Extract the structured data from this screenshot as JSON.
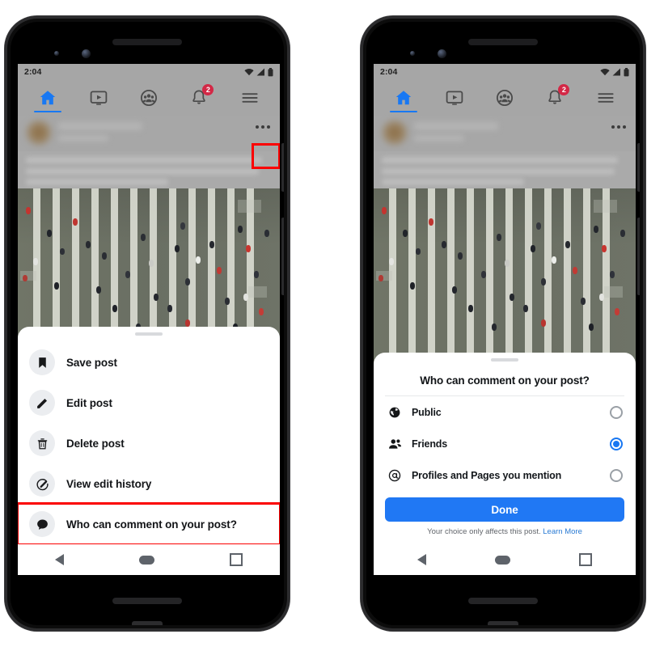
{
  "phones": {
    "left": {
      "label": "facebook-post-options-menu",
      "statusbar": {
        "time": "2:04",
        "icons": [
          "wifi-icon",
          "cellular-signal-icon",
          "battery-icon"
        ]
      },
      "topnav": {
        "items": [
          {
            "name": "home",
            "icon": "home-icon",
            "active": true
          },
          {
            "name": "watch",
            "icon": "video-play-icon",
            "active": false
          },
          {
            "name": "groups",
            "icon": "groups-icon",
            "active": false
          },
          {
            "name": "notifications",
            "icon": "bell-icon",
            "active": false,
            "badge": "2"
          },
          {
            "name": "menu",
            "icon": "hamburger-menu-icon",
            "active": false
          }
        ]
      },
      "post": {
        "author_blurred": true,
        "body_blurred": true,
        "more_options": "more-options-icon"
      },
      "photo": {
        "description": "aerial-view-pedestrian-crosswalk"
      },
      "menu": {
        "items": [
          {
            "label": "Save post",
            "icon": "bookmark-icon",
            "highlighted": false
          },
          {
            "label": "Edit post",
            "icon": "pencil-icon",
            "highlighted": false
          },
          {
            "label": "Delete post",
            "icon": "trash-icon",
            "highlighted": false
          },
          {
            "label": "View edit history",
            "icon": "edit-history-icon",
            "highlighted": false
          },
          {
            "label": "Who can comment on your post?",
            "icon": "comment-bubble-icon",
            "highlighted": true
          }
        ]
      },
      "androidnav": {
        "back": "back-triangle-icon",
        "home": "home-pill-icon",
        "recents": "recents-square-icon"
      }
    },
    "right": {
      "label": "who-can-comment-dialog",
      "statusbar": {
        "time": "2:04",
        "icons": [
          "wifi-icon",
          "cellular-signal-icon",
          "battery-icon"
        ]
      },
      "topnav": {
        "items": [
          {
            "name": "home",
            "icon": "home-icon",
            "active": true
          },
          {
            "name": "watch",
            "icon": "video-play-icon",
            "active": false
          },
          {
            "name": "groups",
            "icon": "groups-icon",
            "active": false
          },
          {
            "name": "notifications",
            "icon": "bell-icon",
            "active": false,
            "badge": "2"
          },
          {
            "name": "menu",
            "icon": "hamburger-menu-icon",
            "active": false
          }
        ]
      },
      "dialog": {
        "title": "Who can comment on your post?",
        "options": [
          {
            "label": "Public",
            "icon": "globe-icon",
            "selected": false
          },
          {
            "label": "Friends",
            "icon": "friends-icon",
            "selected": true
          },
          {
            "label": "Profiles and Pages you mention",
            "icon": "at-mention-icon",
            "selected": false
          }
        ],
        "done_label": "Done",
        "footer_text": "Your choice only affects this post.",
        "footer_link": "Learn More"
      },
      "androidnav": {
        "back": "back-triangle-icon",
        "home": "home-pill-icon",
        "recents": "recents-square-icon"
      }
    }
  },
  "highlight_color": "#fb0000",
  "accent_color": "#1877f2"
}
